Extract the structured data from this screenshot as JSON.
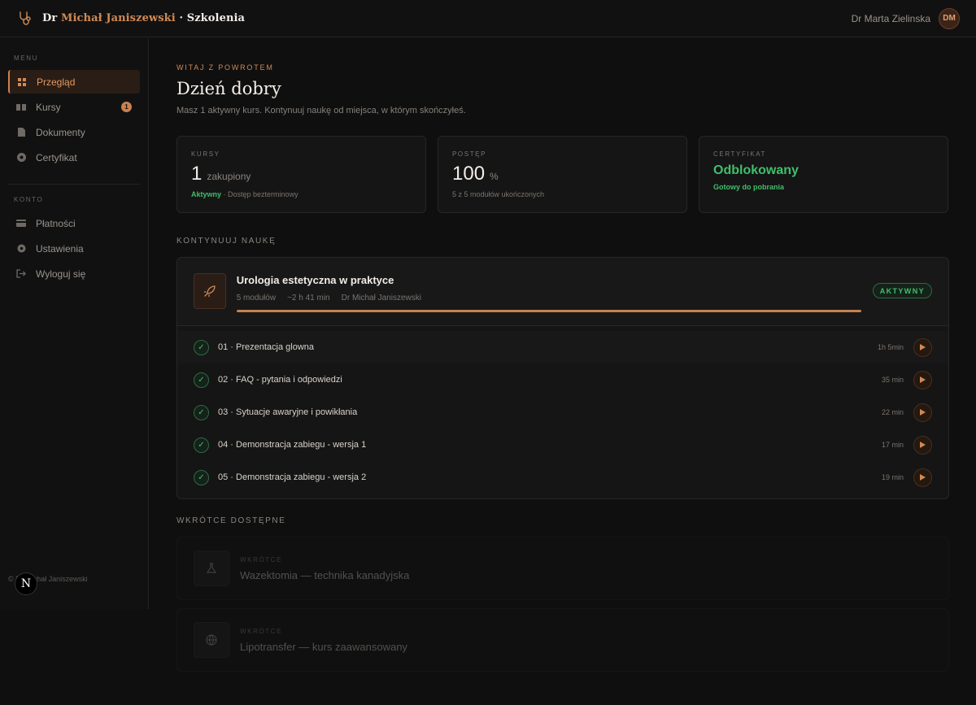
{
  "header": {
    "brand_prefix": "Dr",
    "brand_name": "Michał Janiszewski",
    "brand_suffix": "· Szkolenia",
    "user_name": "Dr Marta Zielinska",
    "avatar_initials": "DM"
  },
  "sidebar": {
    "menu_label": "MENU",
    "account_label": "KONTO",
    "menu_items": [
      {
        "label": "Przegląd",
        "icon": "grid-icon",
        "active": true
      },
      {
        "label": "Kursy",
        "icon": "book-icon",
        "badge": "1"
      },
      {
        "label": "Dokumenty",
        "icon": "document-icon"
      },
      {
        "label": "Certyfikat",
        "icon": "award-icon"
      }
    ],
    "account_items": [
      {
        "label": "Płatności",
        "icon": "credit-card-icon"
      },
      {
        "label": "Ustawienia",
        "icon": "gear-icon"
      },
      {
        "label": "Wyloguj się",
        "icon": "logout-icon"
      }
    ],
    "footer": "© Dr Michał Janiszewski",
    "next_badge": "N"
  },
  "welcome": {
    "eyebrow": "WITAJ Z POWROTEM",
    "title": "Dzień dobry",
    "subtitle": "Masz 1 aktywny kurs. Kontynuuj naukę od miejsca, w którym skończyłeś."
  },
  "stats": {
    "courses": {
      "label": "KURSY",
      "value": "1",
      "unit": "zakupiony",
      "status": "Aktywny",
      "note": "· Dostęp bezterminowy"
    },
    "progress": {
      "label": "POSTĘP",
      "value": "100",
      "unit": "%",
      "note": "5 z 5 modułów ukończonych"
    },
    "certificate": {
      "label": "CERTYFIKAT",
      "value": "Odblokowany",
      "note": "Gotowy do pobrania"
    }
  },
  "continue": {
    "section_title": "KONTYNUUJ NAUKĘ",
    "course": {
      "title": "Urologia estetyczna w praktyce",
      "modules_count": "5 modułów",
      "duration": "~2 h 41 min",
      "author": "Dr Michał Janiszewski",
      "status": "AKTYWNY",
      "progress_percent": 100
    },
    "modules": [
      {
        "title": "01 · Prezentacja glowna",
        "duration": "1h 5min"
      },
      {
        "title": "02 · FAQ - pytania i odpowiedzi",
        "duration": "35 min"
      },
      {
        "title": "03 · Sytuacje awaryjne i powikłania",
        "duration": "22 min"
      },
      {
        "title": "04 · Demonstracja zabiegu - wersja 1",
        "duration": "17 min"
      },
      {
        "title": "05 · Demonstracja zabiegu - wersja 2",
        "duration": "19 min"
      }
    ]
  },
  "upcoming": {
    "section_title": "WKRÓTCE DOSTĘPNE",
    "items": [
      {
        "tag": "WKRÓTCE",
        "title": "Wazektomia — technika kanadyjska",
        "icon": "flask-icon"
      },
      {
        "tag": "WKRÓTCE",
        "title": "Lipotransfer — kurs zaawansowany",
        "icon": "globe-icon"
      }
    ]
  },
  "colors": {
    "accent": "#d08a55",
    "success": "#3fbf6c",
    "background": "#0f0f0f"
  }
}
